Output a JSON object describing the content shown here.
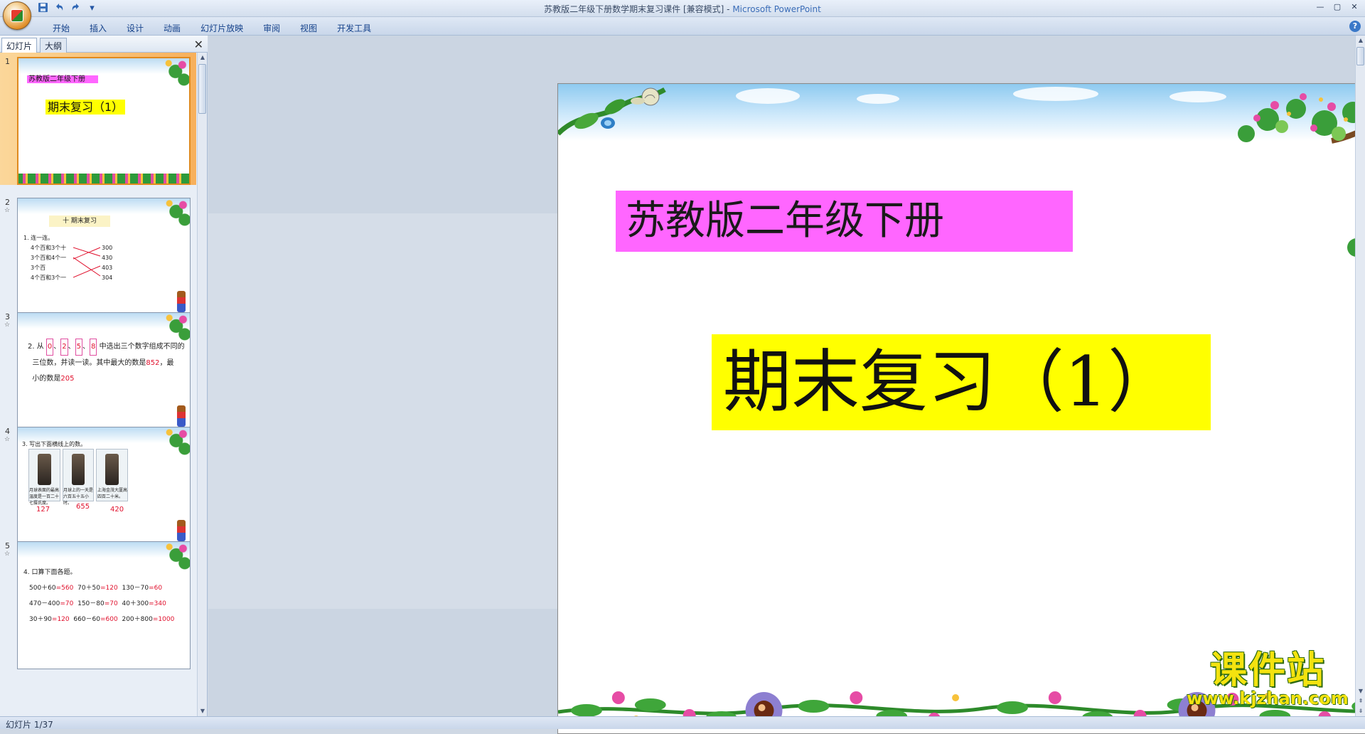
{
  "window": {
    "title": "苏教版二年级下册数学期末复习课件 [兼容模式] - ",
    "app_name": "Microsoft PowerPoint",
    "controls": [
      "—",
      "▢",
      "✕"
    ]
  },
  "quick_access": {
    "save_icon": "save-icon",
    "undo_icon": "undo-icon",
    "redo_icon": "redo-icon",
    "customize": "▾"
  },
  "ribbon": {
    "tabs": [
      "开始",
      "插入",
      "设计",
      "动画",
      "幻灯片放映",
      "审阅",
      "视图",
      "开发工具"
    ],
    "help": "?"
  },
  "left_pane": {
    "tabs": [
      "幻灯片",
      "大纲"
    ],
    "close": "✕",
    "slides": [
      {
        "number": "1",
        "label": "苏教版二年级下册",
        "title": "期末复习（1）"
      },
      {
        "number": "2",
        "heading": "十  期末复习",
        "lines": [
          "1. 连一连。",
          "4个百和3个十",
          "3个百和4个一",
          "3个百",
          "4个百和3个一"
        ],
        "values": [
          "300",
          "430",
          "403",
          "304"
        ]
      },
      {
        "number": "3",
        "text1": "2. 从",
        "digits": [
          "0",
          "2",
          "5",
          "8"
        ],
        "text2": "中选出三个数字组成不同的",
        "text3": "三位数，并读一读。其中最大的数是",
        "max": "852",
        "text4": "，最",
        "text5": "小的数是",
        "min": "205"
      },
      {
        "number": "4",
        "heading": "3. 写出下面横线上的数。",
        "captions": [
          "月球表面的最高温度是一百二十七摄氏度。",
          "月球上的一天是六百五十五小时。",
          "上海金茂大厦高四百二十米。"
        ],
        "answers": [
          "127",
          "655",
          "420"
        ]
      },
      {
        "number": "5",
        "heading": "4. 口算下面各题。",
        "rows": [
          [
            "500＋60",
            "=560",
            "70＋50",
            "=120",
            "130－70",
            "=60"
          ],
          [
            "470－400",
            "=70",
            "150－80",
            "=70",
            "40＋300",
            "=340"
          ],
          [
            "30＋90",
            "=120",
            "660－60",
            "=600",
            "200＋800",
            "=1000"
          ]
        ]
      }
    ]
  },
  "slide": {
    "label": "苏教版二年级下册",
    "title": "期末复习（1）"
  },
  "watermark": {
    "cn": "课件站",
    "url": "www.kjzhan.com"
  },
  "status_bar": {
    "slide_info": "幻灯片 1/37"
  },
  "colors": {
    "label_bg": "#ff66ff",
    "title_bg": "#ffff00",
    "selected_thumb": "#f7b05b",
    "answer_red": "#e0102c"
  }
}
